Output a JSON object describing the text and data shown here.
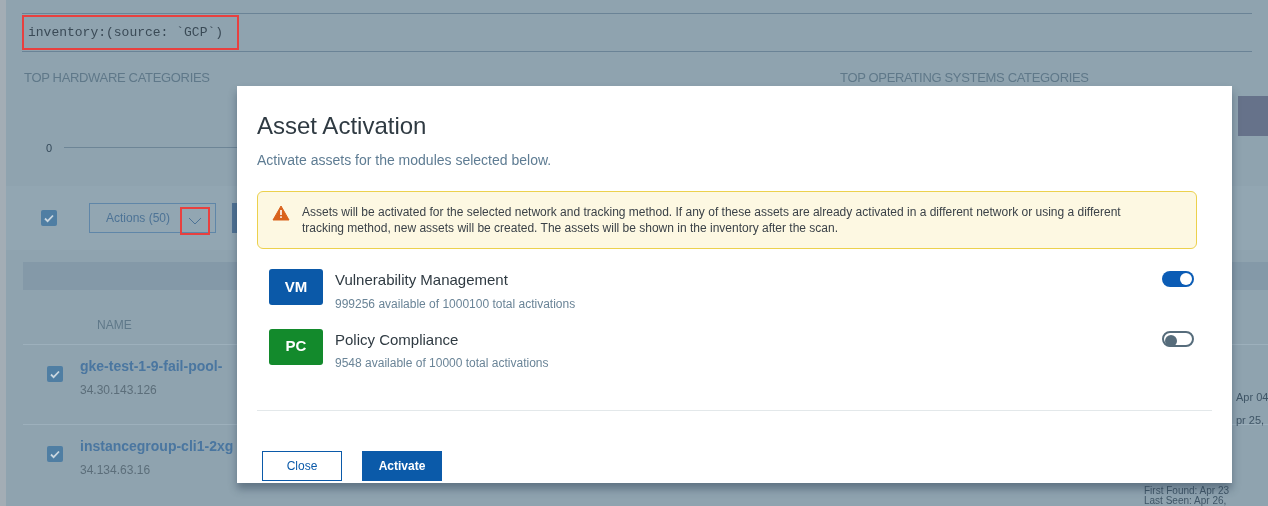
{
  "background": {
    "search_query": "inventory:(source: `GCP`)",
    "headings": [
      "TOP HARDWARE CATEGORIES",
      "TOP OPERATING SYSTEMS CATEGORIES"
    ],
    "chart_axis_label": "0",
    "select_all_checked": true,
    "actions_button": "Actions (50)",
    "table": {
      "columns": [
        "NAME"
      ],
      "rows": [
        {
          "checked": true,
          "name": "gke-test-1-9-fail-pool-",
          "address": "34.30.143.126",
          "column_2": [
            "Apr 04",
            "pr 25,"
          ]
        },
        {
          "checked": true,
          "name": "instancegroup-cli1-2xg",
          "address": "34.134.63.16",
          "column_2": [
            "First Found: Apr 23",
            "Last Seen: Apr 26,"
          ]
        }
      ]
    }
  },
  "dialog": {
    "title": "Asset Activation",
    "subtitle": "Activate assets for the modules selected below.",
    "warning": "Assets will be activated for the selected network and tracking method. If any of these assets are already activated in a different network or using a different tracking method, new assets will be created. The assets will be shown in the inventory after the scan.",
    "modules": [
      {
        "badge": "VM",
        "color": "#0b59a8",
        "name": "Vulnerability Management",
        "availability": "999256 available of 1000100 total activations",
        "on": true
      },
      {
        "badge": "PC",
        "color": "#138a2c",
        "name": "Policy Compliance",
        "availability": "9548 available of 10000 total activations",
        "on": false
      }
    ],
    "buttons": [
      {
        "label": "Close",
        "kind": "secondary"
      },
      {
        "label": "Activate",
        "kind": "primary"
      }
    ]
  }
}
